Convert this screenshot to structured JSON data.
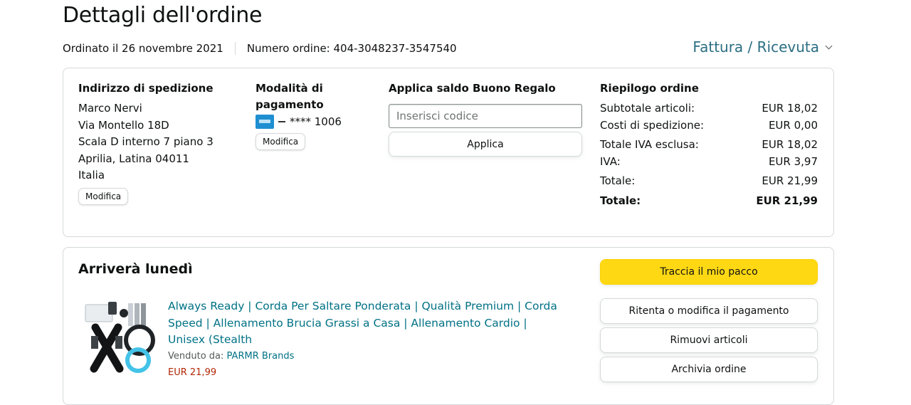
{
  "page": {
    "title": "Dettagli dell'ordine",
    "ordered_on": "Ordinato il 26 novembre 2021",
    "order_number": "Numero ordine: 404-3048237-3547540",
    "invoice_link": "Fattura / Ricevuta"
  },
  "shipping": {
    "heading": "Indirizzo di spedizione",
    "lines": [
      "Marco Nervi",
      "Via Montello 18D",
      "Scala D interno 7 piano 3",
      "Aprilia, Latina 04011",
      "Italia"
    ],
    "edit_label": "Modifica"
  },
  "payment": {
    "heading_line1": "Modalità di",
    "heading_line2": "pagamento",
    "card_digits": "**** 1006",
    "card_icon": "credit-card-icon",
    "edit_label": "Modifica"
  },
  "gift_card": {
    "heading": "Applica saldo Buono Regalo",
    "placeholder": "Inserisci codice",
    "apply_label": "Applica"
  },
  "summary": {
    "heading": "Riepilogo ordine",
    "rows": [
      {
        "label": "Subtotale articoli:",
        "value": "EUR 18,02"
      },
      {
        "label": "Costi di spedizione:",
        "value": "EUR 0,00"
      },
      {
        "label": "Totale IVA esclusa:",
        "value": "EUR 18,02"
      },
      {
        "label": "IVA:",
        "value": "EUR 3,97"
      },
      {
        "label": "Totale:",
        "value": "EUR 21,99"
      }
    ],
    "grand_total": {
      "label": "Totale:",
      "value": "EUR 21,99"
    }
  },
  "shipment": {
    "heading": "Arriverà lunedì",
    "product_title": "Always Ready | Corda Per Saltare Ponderata | Qualità Premium | Corda Speed | Allenamento Brucia Grassi a Casa | Allenamento Cardio | Unisex (Stealth",
    "seller_prefix": "Venduto da:",
    "seller_name": "PARMR Brands",
    "price": "EUR 21,99",
    "actions": {
      "track": "Traccia il mio pacco",
      "retry_payment": "Ritenta o modifica il pagamento",
      "remove_items": "Rimuovi articoli",
      "archive": "Archivia ordine"
    }
  },
  "colors": {
    "link": "#007185",
    "price": "#b12704",
    "primary_button": "#ffd814",
    "border": "#d5d9d9"
  }
}
